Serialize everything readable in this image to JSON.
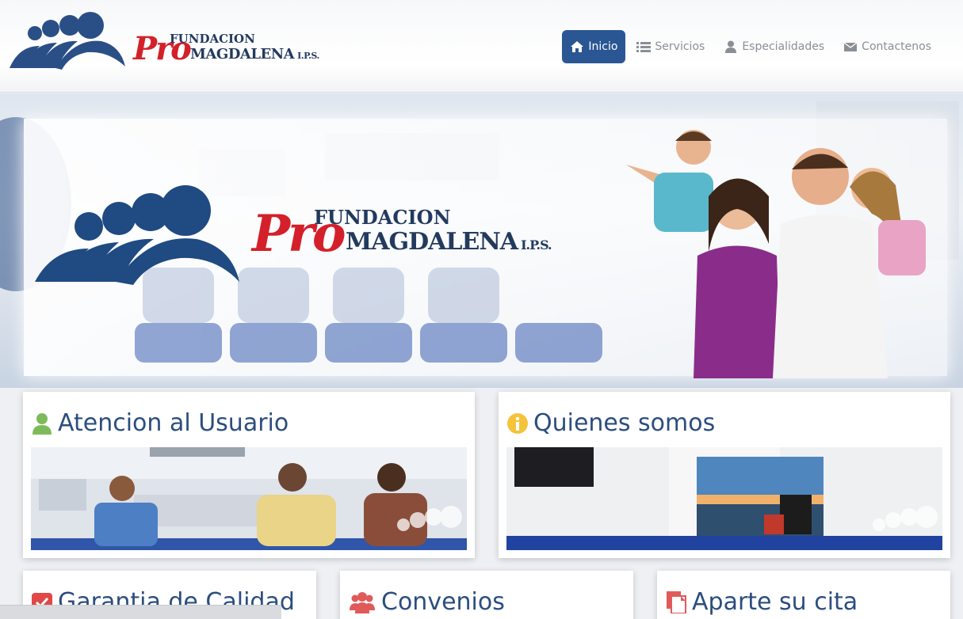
{
  "header": {
    "logo": {
      "pro": "Pro",
      "fundacion": "FUNDACION",
      "magdalena": "MAGDALENA",
      "ips": "I.P.S."
    }
  },
  "nav": {
    "items": [
      {
        "label": "Inicio",
        "icon": "home-icon",
        "active": true
      },
      {
        "label": "Servicios",
        "icon": "list-icon",
        "active": false
      },
      {
        "label": "Especialidades",
        "icon": "doctor-icon",
        "active": false
      },
      {
        "label": "Contactenos",
        "icon": "envelope-icon",
        "active": false
      }
    ]
  },
  "hero": {
    "logo": {
      "pro": "Pro",
      "fundacion": "FUNDACION",
      "magdalena": "MAGDALENA",
      "ips": "I.P.S."
    }
  },
  "cards": [
    {
      "title": "Atencion al Usuario",
      "icon": "user-icon"
    },
    {
      "title": "Quienes somos",
      "icon": "info-icon"
    },
    {
      "title": "Garantia de Calidad",
      "icon": "check-square-icon"
    },
    {
      "title": "Convenios",
      "icon": "group-icon"
    },
    {
      "title": "Aparte su cita",
      "icon": "document-icon"
    }
  ],
  "colors": {
    "brand_blue": "#2a5694",
    "logo_navy": "#233a5e",
    "logo_red": "#d4202a",
    "title_blue": "#2c4e7e"
  }
}
